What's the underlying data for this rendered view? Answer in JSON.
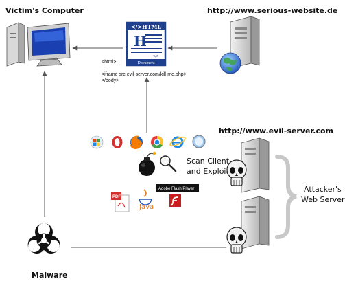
{
  "labels": {
    "victim": "Victim's Computer",
    "serious_url": "http://www.serious-website.de",
    "evil_url": "http://www.evil-server.com",
    "scan_line1": "Scan Client",
    "scan_line2": "and Exploit",
    "attacker_line1": "Attacker's",
    "attacker_line2": "Web Server",
    "malware": "Malware"
  },
  "document": {
    "header": "</>HTML",
    "footer": "Document",
    "letter": "H",
    "tag": "</>"
  },
  "code_lines": [
    "<html>",
    "...",
    "<iframe src evil-server.com/kill-me.php>",
    "</body>"
  ],
  "plugins": {
    "java": "Java",
    "flash_caption": "Adobe Flash Player",
    "pdf": "PDF"
  },
  "colors": {
    "doc_blue": "#1f3f8f",
    "globe_blue": "#2f6fd0",
    "arrow": "#666666",
    "brace": "#c8c8c8",
    "java_orange": "#e07b1a",
    "flash_red": "#c81e1e"
  }
}
